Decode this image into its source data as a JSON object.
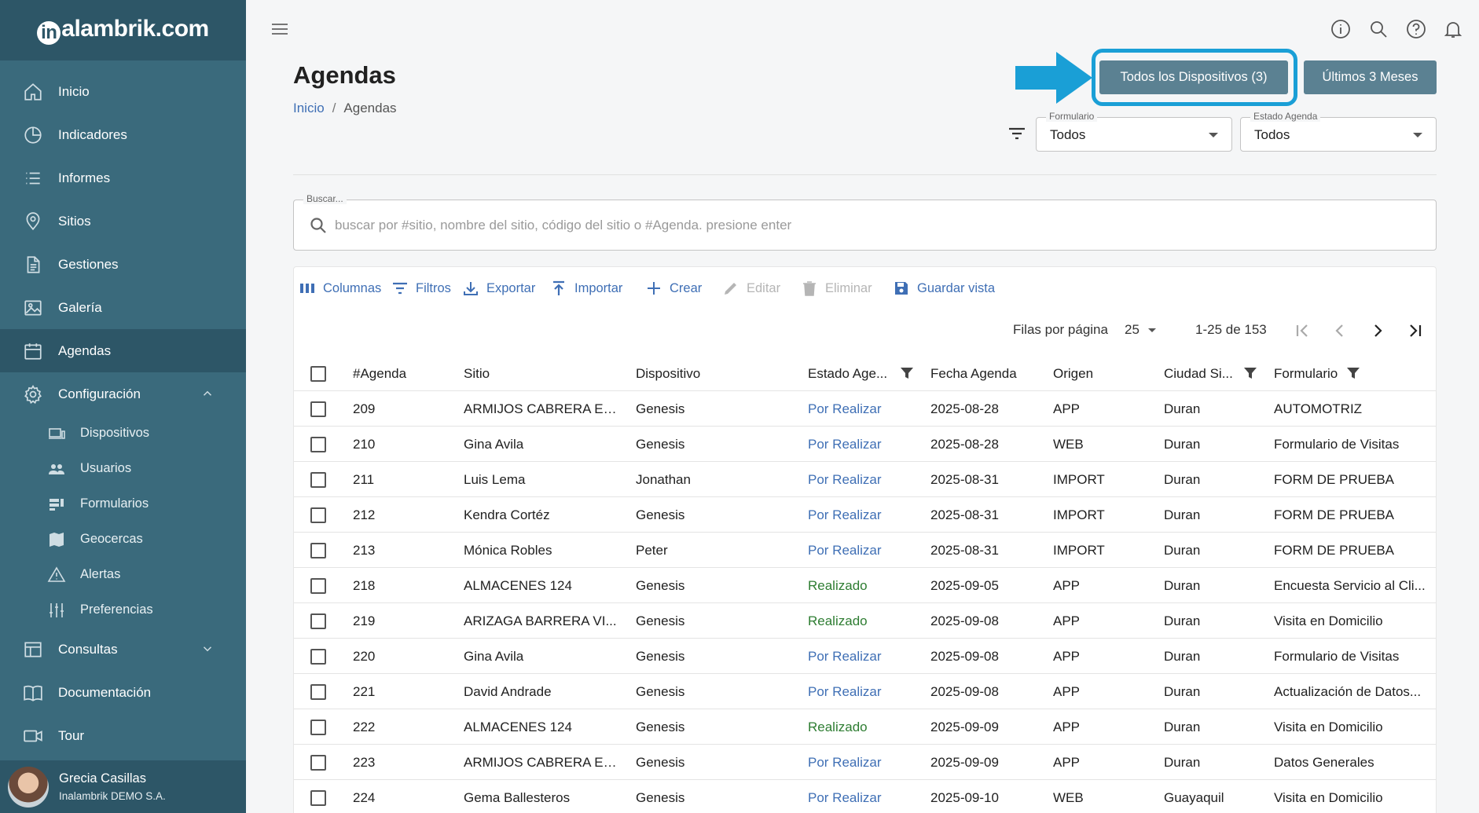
{
  "app": {
    "logo_text": "alambrik.com",
    "logo_initial": "in"
  },
  "sidebar": {
    "items": [
      {
        "label": "Inicio",
        "icon": "home-icon"
      },
      {
        "label": "Indicadores",
        "icon": "pie-chart-icon"
      },
      {
        "label": "Informes",
        "icon": "list-icon"
      },
      {
        "label": "Sitios",
        "icon": "location-pin-icon"
      },
      {
        "label": "Gestiones",
        "icon": "document-icon"
      },
      {
        "label": "Galería",
        "icon": "image-icon"
      },
      {
        "label": "Agendas",
        "icon": "calendar-icon",
        "active": true
      },
      {
        "label": "Configuración",
        "icon": "gear-icon",
        "expanded": true
      },
      {
        "label": "Consultas",
        "icon": "table-icon",
        "expanded": false
      },
      {
        "label": "Documentación",
        "icon": "book-icon"
      },
      {
        "label": "Tour",
        "icon": "video-icon"
      }
    ],
    "config_sub": [
      {
        "label": "Dispositivos",
        "icon": "devices-icon"
      },
      {
        "label": "Usuarios",
        "icon": "users-icon"
      },
      {
        "label": "Formularios",
        "icon": "forms-icon"
      },
      {
        "label": "Geocercas",
        "icon": "map-icon"
      },
      {
        "label": "Alertas",
        "icon": "warning-icon"
      },
      {
        "label": "Preferencias",
        "icon": "sliders-icon"
      }
    ],
    "user": {
      "name": "Grecia Casillas",
      "org": "Inalambrik DEMO S.A."
    }
  },
  "header": {
    "title": "Agendas",
    "breadcrumb": {
      "home": "Inicio",
      "current": "Agendas",
      "sep": "/"
    },
    "btn_dispositivos": "Todos los Dispositivos (3)",
    "btn_meses": "Últimos 3 Meses",
    "filters": {
      "formulario": {
        "label": "Formulario",
        "value": "Todos"
      },
      "estado": {
        "label": "Estado Agenda",
        "value": "Todos"
      }
    }
  },
  "search": {
    "label": "Buscar...",
    "placeholder": "buscar por #sitio, nombre del sitio, código del sitio o #Agenda. presione enter",
    "value": ""
  },
  "toolbar": {
    "columnas": "Columnas",
    "filtros": "Filtros",
    "exportar": "Exportar",
    "importar": "Importar",
    "crear": "Crear",
    "editar": "Editar",
    "eliminar": "Eliminar",
    "guardar": "Guardar vista"
  },
  "pagination": {
    "rows_label": "Filas por página",
    "rows_value": "25",
    "range": "1-25 de 153"
  },
  "table": {
    "headers": {
      "agenda": "#Agenda",
      "sitio": "Sitio",
      "dispositivo": "Dispositivo",
      "estado": "Estado Age...",
      "fecha": "Fecha Agenda",
      "origen": "Origen",
      "ciudad": "Ciudad Si...",
      "formulario": "Formulario"
    },
    "rows": [
      {
        "agenda": "209",
        "sitio": "ARMIJOS CABRERA ED...",
        "dispositivo": "Genesis",
        "estado": "Por Realizar",
        "fecha": "2025-08-28",
        "origen": "APP",
        "ciudad": "Duran",
        "formulario": "AUTOMOTRIZ"
      },
      {
        "agenda": "210",
        "sitio": "Gina Avila",
        "dispositivo": "Genesis",
        "estado": "Por Realizar",
        "fecha": "2025-08-28",
        "origen": "WEB",
        "ciudad": "Duran",
        "formulario": "Formulario de Visitas"
      },
      {
        "agenda": "211",
        "sitio": "Luis Lema",
        "dispositivo": "Jonathan",
        "estado": "Por Realizar",
        "fecha": "2025-08-31",
        "origen": "IMPORT",
        "ciudad": "Duran",
        "formulario": "FORM DE PRUEBA"
      },
      {
        "agenda": "212",
        "sitio": "Kendra Cortéz",
        "dispositivo": "Genesis",
        "estado": "Por Realizar",
        "fecha": "2025-08-31",
        "origen": "IMPORT",
        "ciudad": "Duran",
        "formulario": "FORM DE PRUEBA"
      },
      {
        "agenda": "213",
        "sitio": "Mónica Robles",
        "dispositivo": "Peter",
        "estado": "Por Realizar",
        "fecha": "2025-08-31",
        "origen": "IMPORT",
        "ciudad": "Duran",
        "formulario": "FORM DE PRUEBA"
      },
      {
        "agenda": "218",
        "sitio": "ALMACENES 124",
        "dispositivo": "Genesis",
        "estado": "Realizado",
        "fecha": "2025-09-05",
        "origen": "APP",
        "ciudad": "Duran",
        "formulario": "Encuesta Servicio al Cli..."
      },
      {
        "agenda": "219",
        "sitio": "ARIZAGA BARRERA VI...",
        "dispositivo": "Genesis",
        "estado": "Realizado",
        "fecha": "2025-09-08",
        "origen": "APP",
        "ciudad": "Duran",
        "formulario": "Visita en Domicilio"
      },
      {
        "agenda": "220",
        "sitio": "Gina Avila",
        "dispositivo": "Genesis",
        "estado": "Por Realizar",
        "fecha": "2025-09-08",
        "origen": "APP",
        "ciudad": "Duran",
        "formulario": "Formulario de Visitas"
      },
      {
        "agenda": "221",
        "sitio": "David Andrade",
        "dispositivo": "Genesis",
        "estado": "Por Realizar",
        "fecha": "2025-09-08",
        "origen": "APP",
        "ciudad": "Duran",
        "formulario": "Actualización de Datos..."
      },
      {
        "agenda": "222",
        "sitio": "ALMACENES 124",
        "dispositivo": "Genesis",
        "estado": "Realizado",
        "fecha": "2025-09-09",
        "origen": "APP",
        "ciudad": "Duran",
        "formulario": "Visita en Domicilio"
      },
      {
        "agenda": "223",
        "sitio": "ARMIJOS CABRERA ED...",
        "dispositivo": "Genesis",
        "estado": "Por Realizar",
        "fecha": "2025-09-09",
        "origen": "APP",
        "ciudad": "Duran",
        "formulario": "Datos Generales"
      },
      {
        "agenda": "224",
        "sitio": "Gema Ballesteros",
        "dispositivo": "Genesis",
        "estado": "Por Realizar",
        "fecha": "2025-09-10",
        "origen": "WEB",
        "ciudad": "Guayaquil",
        "formulario": "Visita en Domicilio"
      }
    ]
  },
  "colors": {
    "sidebar": "#3a6a7c",
    "sidebar_dark": "#2d5667",
    "accent": "#3f6fb5",
    "highlight": "#1a9fd6",
    "done": "#2e7d32"
  }
}
